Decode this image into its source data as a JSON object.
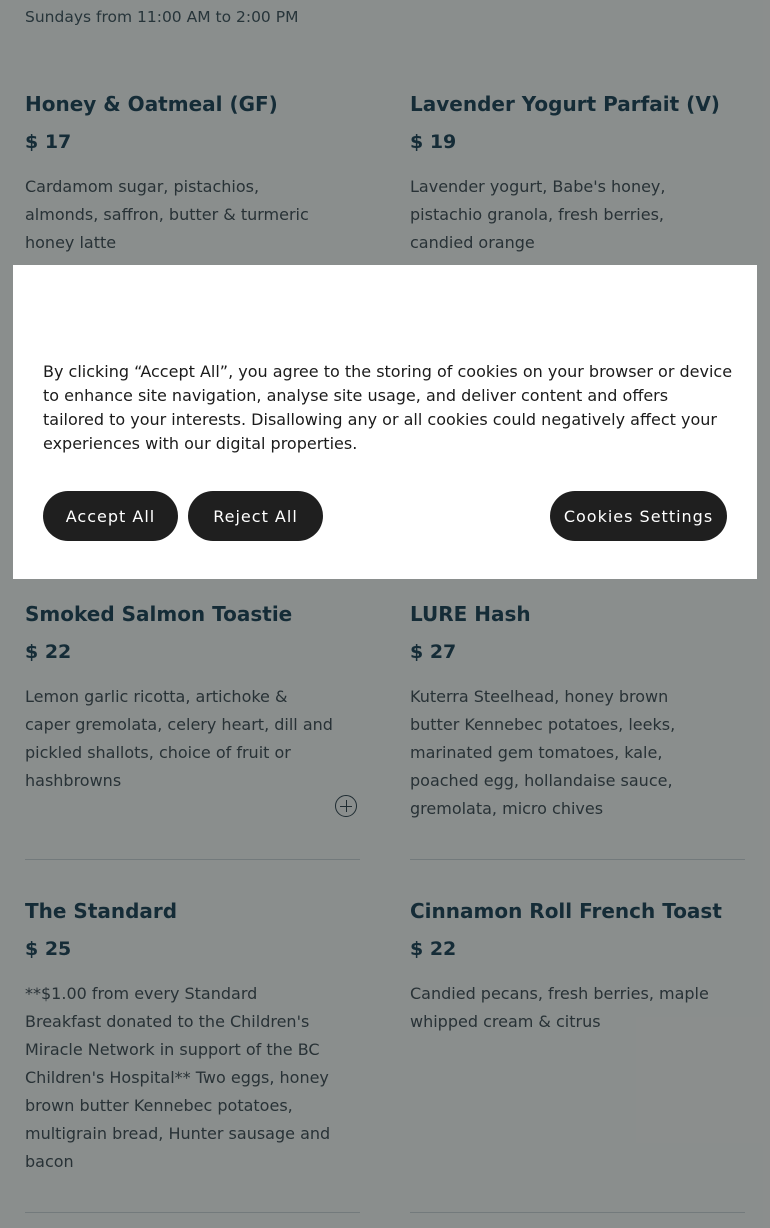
{
  "hours_text": "Sundays from 11:00 AM to 2:00 PM",
  "menu": {
    "items": [
      {
        "name": "Honey & Oatmeal (GF)",
        "price": "$ 17",
        "desc": "Cardamom sugar, pistachios, almonds, saffron, butter & turmeric honey latte"
      },
      {
        "name": "Lavender Yogurt Parfait (V)",
        "price": "$ 19",
        "desc": "Lavender yogurt, Babe's honey, pistachio granola, fresh berries, candied orange"
      },
      {
        "name": "Smoked Salmon Toastie",
        "price": "$ 22",
        "desc": "Lemon garlic ricotta, artichoke & caper gremolata, celery heart, dill and pickled shallots, choice of fruit or hashbrowns"
      },
      {
        "name": "LURE Hash",
        "price": "$ 27",
        "desc": "Kuterra Steelhead, honey brown butter Kennebec potatoes, leeks, marinated gem tomatoes, kale, poached egg, hollandaise sauce, gremolata, micro chives"
      },
      {
        "name": "The Standard",
        "price": "$ 25",
        "desc": "**$1.00 from every Standard Breakfast donated to the Children's Miracle Network in support of the BC Children's Hospital** Two eggs, honey brown butter Kennebec potatoes, multigrain bread, Hunter sausage and bacon"
      },
      {
        "name": "Cinnamon Roll French Toast",
        "price": "$ 22",
        "desc": "Candied pecans, fresh berries, maple whipped cream & citrus"
      }
    ]
  },
  "cookie_banner": {
    "text": "By clicking “Accept All”, you agree to the storing of cookies on your browser or device to enhance site navigation, analyse site usage, and deliver content and offers tailored to your interests. Disallowing any or all cookies could negatively affect your experiences with our digital properties.",
    "accept_label": "Accept All",
    "reject_label": "Reject All",
    "settings_label": "Cookies Settings"
  },
  "icons": {
    "expand": "plus-circle-icon"
  },
  "colors": {
    "overlay": "#1e2a30",
    "button": "#1f1f1f",
    "heading": "#17394a"
  }
}
